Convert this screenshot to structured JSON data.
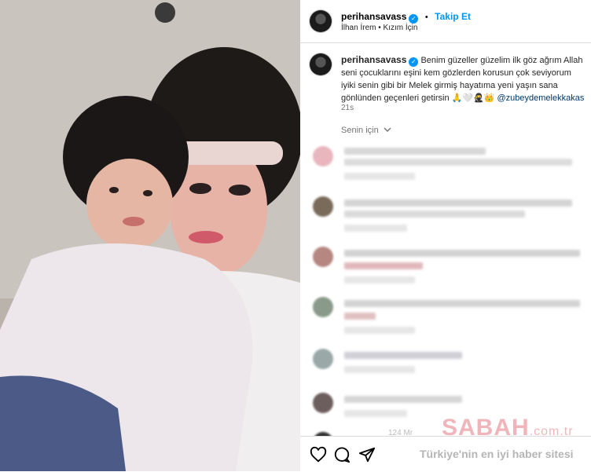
{
  "post": {
    "username": "perihansavass",
    "separator": "•",
    "follow_label": "Takip Et",
    "audio_label": "İlhan İrem • Kızım İçin",
    "caption_username": "perihansavass",
    "caption_text": "Benim güzeller güzelim ilk göz ağrım Allah seni çocuklarını eşini kem gözlerden korusun çok seviyorum iyiki senin gibi bir Melek girmiş hayatıma yeni yaşın sana gönlünden geçenleri getirsin 🙏🤍🥷👑",
    "mention": "@zubeydemelekkakas",
    "time_ago": "21s",
    "sort_label": "Senin için",
    "sort_icon": "chevron-down-icon"
  },
  "actions": {
    "like_icon": "heart-icon",
    "comment_icon": "comment-icon",
    "share_icon": "send-icon",
    "partial_text": "124 Mr"
  },
  "watermark": {
    "brand": "SABAH",
    "domain": ".com.tr",
    "tagline": "Türkiye'nin en iyi haber sitesi"
  },
  "colors": {
    "accent": "#0095f6",
    "text": "#262626",
    "muted": "#737373",
    "mention": "#00376b"
  }
}
